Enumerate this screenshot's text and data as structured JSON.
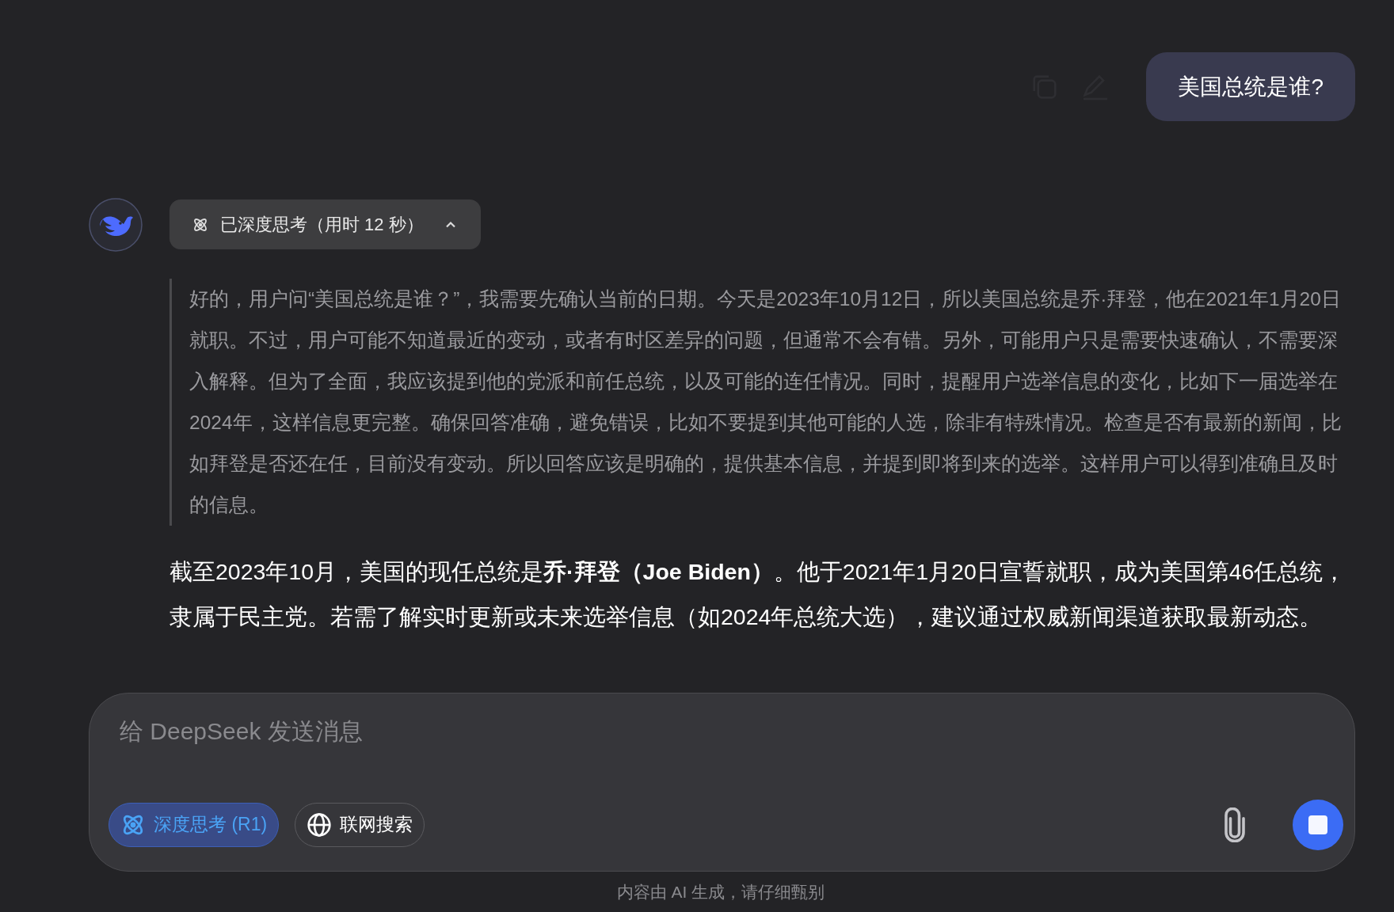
{
  "user_message": {
    "text": "美国总统是谁?"
  },
  "assistant": {
    "thinking_toggle": {
      "label": "已深度思考（用时 12 秒）",
      "expanded": true
    },
    "thought": "好的，用户问“美国总统是谁？”，我需要先确认当前的日期。今天是2023年10月12日，所以美国总统是乔·拜登，他在2021年1月20日就职。不过，用户可能不知道最近的变动，或者有时区差异的问题，但通常不会有错。另外，可能用户只是需要快速确认，不需要深入解释。但为了全面，我应该提到他的党派和前任总统，以及可能的连任情况。同时，提醒用户选举信息的变化，比如下一届选举在2024年，这样信息更完整。确保回答准确，避免错误，比如不要提到其他可能的人选，除非有特殊情况。检查是否有最新的新闻，比如拜登是否还在任，目前没有变动。所以回答应该是明确的，提供基本信息，并提到即将到来的选举。这样用户可以得到准确且及时的信息。",
    "answer": "截至2023年10月，美国的现任总统是**乔·拜登（Joe Biden）**。他于2021年1月20日宣誓就职，成为美国第46任总统，隶属于民主党。若需了解实时更新或未来选举信息（如2024年总统大选），建议通过权威新闻渠道获取最新动态。"
  },
  "composer": {
    "placeholder": "给 DeepSeek 发送消息",
    "toggles": [
      {
        "kind": "deepthink",
        "label": "深度思考 (R1)",
        "selected": true
      },
      {
        "kind": "search",
        "label": "联网搜索",
        "selected": false
      }
    ]
  },
  "footer": "内容由 AI 生成，请仔细甄别"
}
